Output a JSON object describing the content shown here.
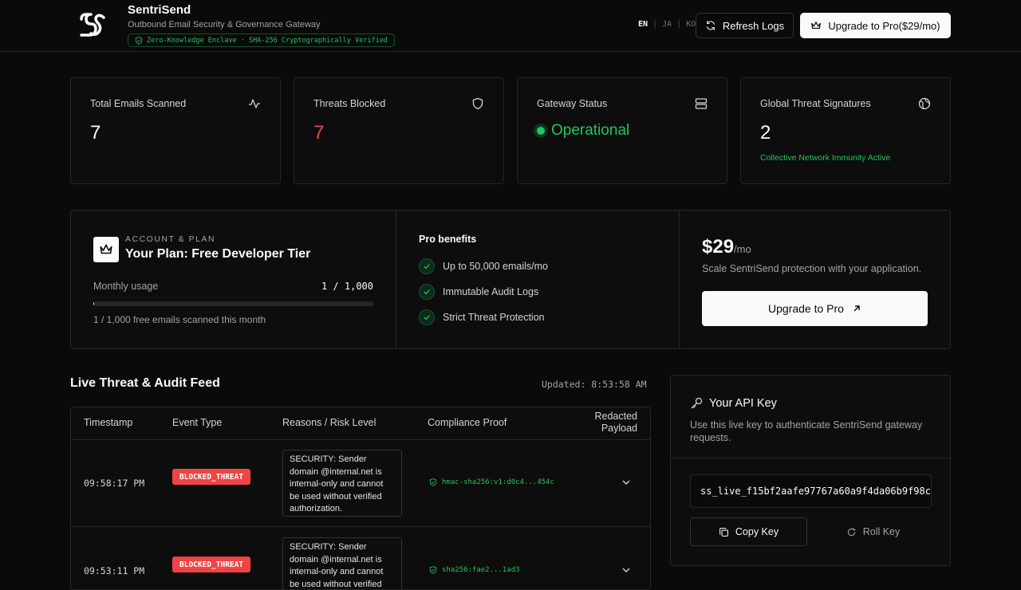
{
  "header": {
    "brand_name": "SentriSend",
    "brand_subtitle": "Outbound Email Security & Governance Gateway",
    "verified_text": "Zero-Knowledge Enclave · SHA-256 Cryptographically Verified",
    "languages": [
      "EN",
      "JA",
      "KO"
    ],
    "active_language": "EN",
    "refresh_label": "Refresh Logs",
    "upgrade_label": "Upgrade to Pro($29/mo)"
  },
  "stats": {
    "total_scanned": {
      "label": "Total Emails Scanned",
      "value": "7",
      "icon": "activity-icon"
    },
    "threats_blocked": {
      "label": "Threats Blocked",
      "value": "7",
      "icon": "shield-icon",
      "color": "#ef4444"
    },
    "gateway_status": {
      "label": "Gateway Status",
      "value": "Operational",
      "icon": "server-icon",
      "color": "#22c55e"
    },
    "global_signatures": {
      "label": "Global Threat Signatures",
      "value": "2",
      "note": "Collective Network Immunity Active",
      "icon": "globe-icon"
    }
  },
  "plan": {
    "section_label": "ACCOUNT & PLAN",
    "title": "Your Plan: Free Developer Tier",
    "usage_label": "Monthly usage",
    "usage_value": "1 / 1,000",
    "usage_fraction": 0.001,
    "usage_note": "1 / 1,000 free emails scanned this month",
    "benefits_title": "Pro benefits",
    "benefits": [
      "Up to 50,000 emails/mo",
      "Immutable Audit Logs",
      "Strict Threat Protection"
    ],
    "price": "$29",
    "price_period": "/mo",
    "price_desc": "Scale SentriSend protection with your application.",
    "upgrade_button": "Upgrade to Pro"
  },
  "feed": {
    "title": "Live Threat & Audit Feed",
    "updated": "Updated: 8:53:58 AM",
    "columns": [
      "Timestamp",
      "Event Type",
      "Reasons / Risk Level",
      "Compliance Proof",
      "Redacted Payload"
    ],
    "rows": [
      {
        "timestamp": "09:58:17 PM",
        "event": "BLOCKED_THREAT",
        "reason": "SECURITY: Sender domain @internal.net is internal-only and cannot be used without verified authorization.",
        "proof": "hmac-sha256:v1:d0c4...454c"
      },
      {
        "timestamp": "09:53:11 PM",
        "event": "BLOCKED_THREAT",
        "reason": "SECURITY: Sender domain @internal.net is internal-only and cannot be used without verified authorization.",
        "proof": "sha256:fae2...1ad3"
      }
    ]
  },
  "api": {
    "title": "Your API Key",
    "description": "Use this live key to authenticate SentriSend gateway requests.",
    "key": "ss_live_f15bf2aafe97767a60a9f4da06b9f98c",
    "copy_label": "Copy Key",
    "roll_label": "Roll Key"
  }
}
